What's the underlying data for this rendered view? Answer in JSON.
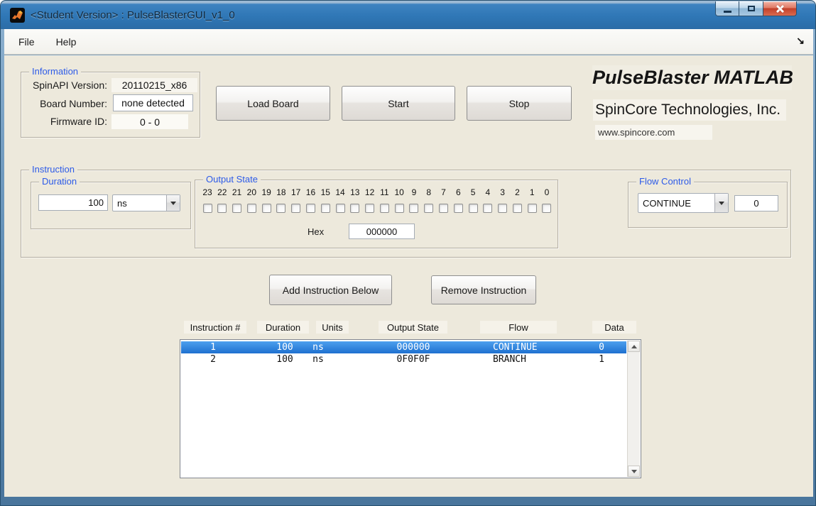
{
  "window": {
    "title": "<Student Version> : PulseBlasterGUI_v1_0"
  },
  "menu": {
    "file": "File",
    "help": "Help",
    "dock_arrow_icon": "↘"
  },
  "information": {
    "title": "Information",
    "spinapi_label": "SpinAPI Version:",
    "spinapi_value": "20110215_x86",
    "board_label": "Board Number:",
    "board_value": "none detected",
    "firmware_label": "Firmware ID:",
    "firmware_value": "0 - 0"
  },
  "buttons": {
    "load_board": "Load Board",
    "start": "Start",
    "stop": "Stop",
    "add_instruction": "Add Instruction Below",
    "remove_instruction": "Remove Instruction"
  },
  "branding": {
    "product": "PulseBlaster MATLAB",
    "company": "SpinCore Technologies, Inc.",
    "website": "www.spincore.com"
  },
  "instruction": {
    "title": "Instruction",
    "duration": {
      "title": "Duration",
      "value": "100",
      "unit": "ns"
    },
    "output_state": {
      "title": "Output State",
      "bits": [
        "23",
        "22",
        "21",
        "20",
        "19",
        "18",
        "17",
        "16",
        "15",
        "14",
        "13",
        "12",
        "11",
        "10",
        "9",
        "8",
        "7",
        "6",
        "5",
        "4",
        "3",
        "2",
        "1",
        "0"
      ],
      "hex_label": "Hex",
      "hex_value": "000000"
    },
    "flow_control": {
      "title": "Flow Control",
      "selected": "CONTINUE",
      "data_value": "0"
    }
  },
  "instruction_table": {
    "headers": [
      "Instruction #",
      "Duration",
      "Units",
      "Output State",
      "Flow",
      "Data"
    ],
    "rows": [
      {
        "num": "1",
        "duration": "100",
        "units": "ns",
        "output": "000000",
        "flow": "CONTINUE",
        "data": "0",
        "selected": true
      },
      {
        "num": "2",
        "duration": "100",
        "units": "ns",
        "output": "0F0F0F",
        "flow": "BRANCH",
        "data": "1",
        "selected": false
      }
    ]
  },
  "colors": {
    "titlebar_blue": "#2F77B6",
    "panel_title_blue": "#2D5BE8",
    "selection_blue": "#2A7FDE",
    "client_background": "#EDE9DC"
  }
}
